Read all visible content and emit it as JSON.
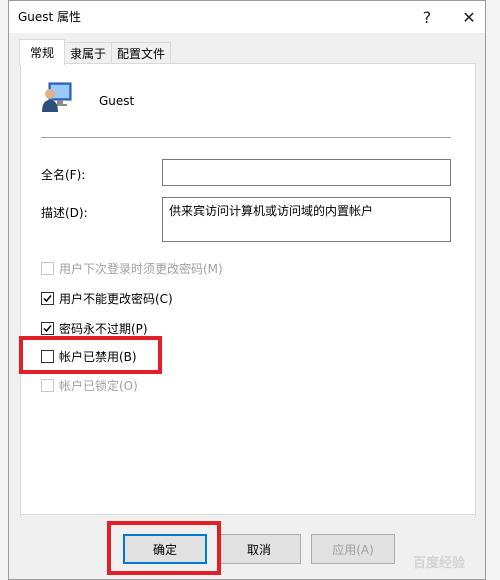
{
  "window": {
    "title": "Guest 属性",
    "help_label": "?",
    "close_label": "✕"
  },
  "tabs": [
    {
      "label": "常规",
      "active": true
    },
    {
      "label": "隶属于",
      "active": false
    },
    {
      "label": "配置文件",
      "active": false
    }
  ],
  "general": {
    "username": "Guest",
    "fullname_label": "全名(F):",
    "fullname_value": "",
    "description_label": "描述(D):",
    "description_value": "供来宾访问计算机或访问域的内置帐户"
  },
  "checkboxes": [
    {
      "label": "用户下次登录时须更改密码(M)",
      "checked": false,
      "enabled": false
    },
    {
      "label": "用户不能更改密码(C)",
      "checked": true,
      "enabled": true
    },
    {
      "label": "密码永不过期(P)",
      "checked": true,
      "enabled": true
    },
    {
      "label": "帐户已禁用(B)",
      "checked": false,
      "enabled": true
    },
    {
      "label": "帐户已锁定(O)",
      "checked": false,
      "enabled": false
    }
  ],
  "buttons": {
    "ok": "确定",
    "cancel": "取消",
    "apply": "应用(A)"
  },
  "colors": {
    "highlight": "#e21f26",
    "accent": "#0078d7"
  },
  "watermark": "百度经验"
}
